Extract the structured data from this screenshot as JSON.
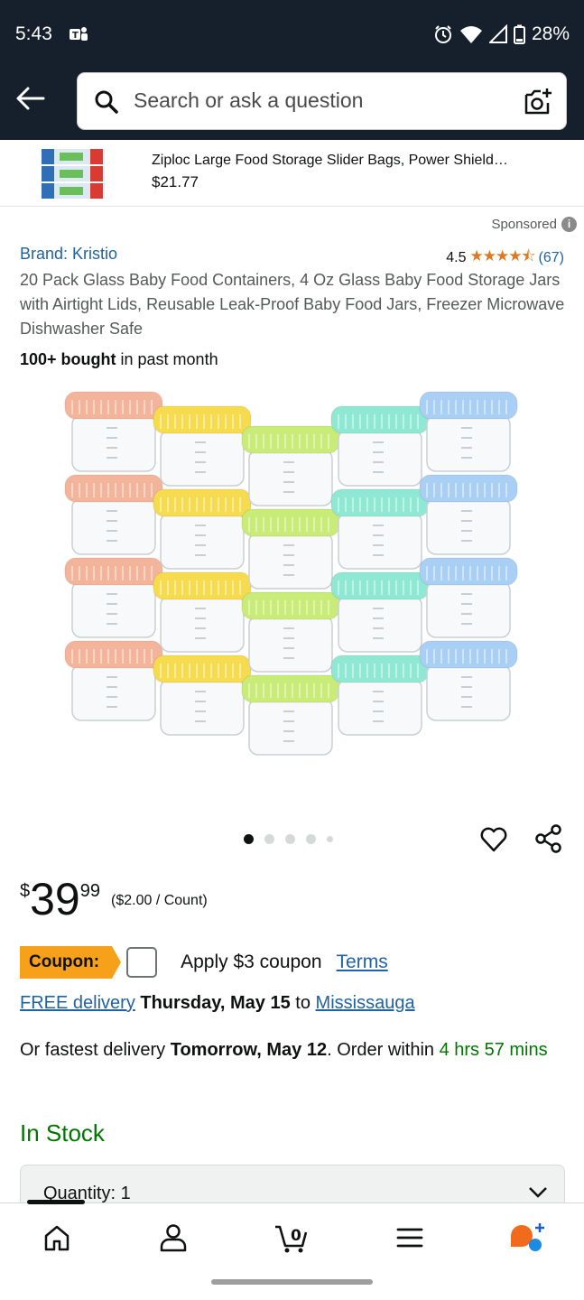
{
  "status_bar": {
    "time": "5:43",
    "battery": "28%",
    "icons": [
      "teams-icon",
      "alarm-icon",
      "wifi-icon",
      "signal-icon",
      "battery-icon"
    ]
  },
  "header": {
    "search_placeholder": "Search or ask a question",
    "icons": [
      "back-arrow-icon",
      "search-icon",
      "camera-icon"
    ]
  },
  "sponsored_banner": {
    "title": "Ziploc Large Food Storage Slider Bags, Power Shield…",
    "price": "$21.77"
  },
  "product": {
    "sponsored_label": "Sponsored",
    "brand": "Brand: Kristio",
    "rating": "4.5",
    "stars": "★★★★⯪",
    "review_count": "(67)",
    "title": "20 Pack Glass Baby Food Containers, 4 Oz Glass Baby Food Storage Jars with Airtight Lids, Reusable Leak-Proof Baby Food Jars, Freezer Microwave Dishwasher Safe",
    "bought_bold": "100+ bought",
    "bought_rest": " in past month",
    "lid_colors": [
      "#f4b49a",
      "#f7db4f",
      "#c9ec78",
      "#8fe8d3",
      "#a9cff5"
    ]
  },
  "price": {
    "symbol": "$",
    "whole": "39",
    "fraction": "99",
    "per_unit": "($2.00 / Count)"
  },
  "coupon": {
    "tag": "Coupon:",
    "apply": "Apply $3 coupon",
    "terms": "Terms"
  },
  "delivery": {
    "free": "FREE delivery",
    "date": " Thursday, May 15",
    "to": " to ",
    "location": "Mississauga",
    "fastest_prefix": "Or fastest delivery ",
    "fastest_date": "Tomorrow, May 12",
    "order_within": ". Order within ",
    "countdown": "4 hrs 57 mins"
  },
  "stock": "In Stock",
  "quantity": "Quantity: 1",
  "bottom_nav": [
    "home-icon",
    "account-icon",
    "cart-icon",
    "menu-icon",
    "rufus-icon"
  ],
  "cart_count": "0"
}
